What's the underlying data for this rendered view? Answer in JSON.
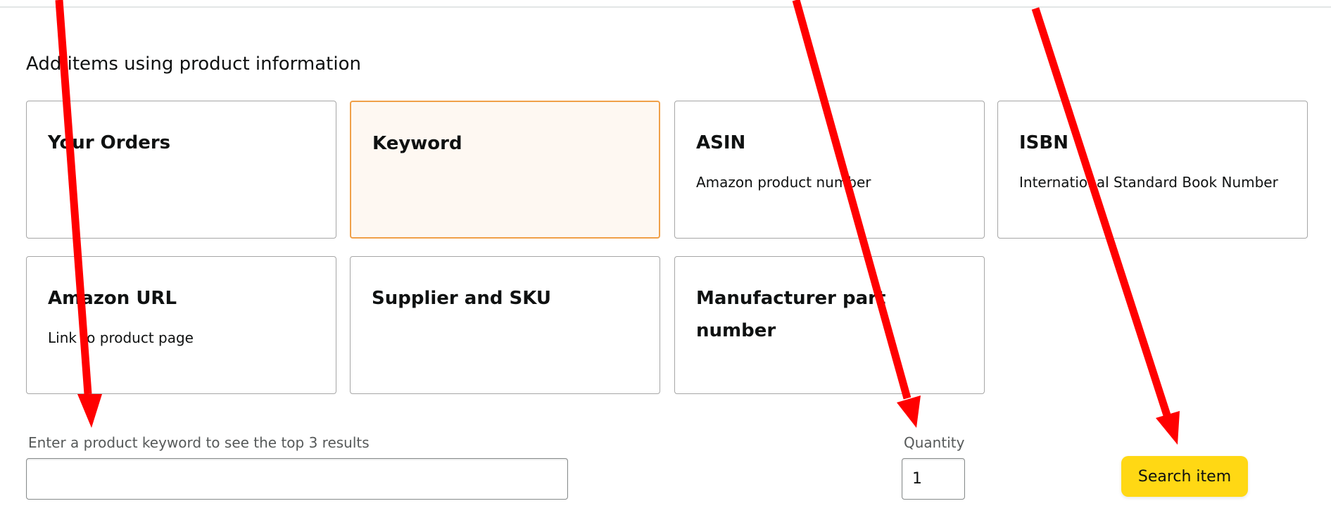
{
  "section": {
    "title": "Add items using product information"
  },
  "cards": [
    {
      "title": "Your Orders",
      "subtitle": ""
    },
    {
      "title": "Keyword",
      "subtitle": "",
      "selected": true
    },
    {
      "title": "ASIN",
      "subtitle": "Amazon product number"
    },
    {
      "title": "ISBN",
      "subtitle": "International Standard Book Number"
    },
    {
      "title": "Amazon URL",
      "subtitle": "Link to product page"
    },
    {
      "title": "Supplier and SKU",
      "subtitle": ""
    },
    {
      "title": "Manufacturer part number",
      "subtitle": ""
    }
  ],
  "keyword_field": {
    "label": "Enter a product keyword to see the top 3 results",
    "value": "",
    "placeholder": ""
  },
  "quantity_field": {
    "label": "Quantity",
    "value": "1"
  },
  "search_button": {
    "label": "Search item"
  },
  "colors": {
    "selected_border": "#f0a049",
    "selected_background": "#fef8f2",
    "button_background": "#ffd814",
    "annotation_arrow": "#ff0000"
  }
}
